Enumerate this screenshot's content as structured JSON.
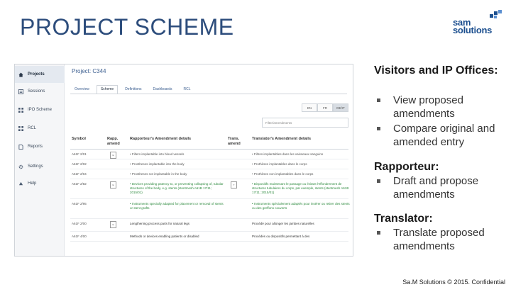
{
  "slide": {
    "title": "PROJECT SCHEME",
    "logo_line1": "sam",
    "logo_line2": "solutions",
    "footer": "Sa.M Solutions © 2015. Confidential"
  },
  "app": {
    "sidebar": {
      "items": [
        {
          "label": "Projects",
          "icon": "home-icon"
        },
        {
          "label": "Sessions",
          "icon": "list-icon"
        },
        {
          "label": "IPO Scheme",
          "icon": "grid-icon"
        },
        {
          "label": "RCL",
          "icon": "grid-icon"
        },
        {
          "label": "Reports",
          "icon": "document-icon"
        },
        {
          "label": "Settings",
          "icon": "gear-icon"
        },
        {
          "label": "Help",
          "icon": "help-icon"
        }
      ]
    },
    "project_title": "Project: C344",
    "tabs": [
      "Overview",
      "Scheme",
      "Definitions",
      "Dashboards",
      "RCL"
    ],
    "active_tab": "Scheme",
    "language_buttons": [
      "EN",
      "FR",
      "DE/IT"
    ],
    "filter_placeholder": "Filter/amendments",
    "table": {
      "headers": {
        "symbol": "Symbol",
        "rapp_amend": "Rapp. amend",
        "rapp_details": "Rapporteur's Amendment details",
        "trans_amend": "Trans. amend",
        "trans_details": "Translator's Amendment details"
      },
      "rows": [
        {
          "symbol": "A61F 2/01",
          "rapp_badge": "E",
          "rapp": "• Filters implantable into blood vessels",
          "trans_badge": "",
          "trans": "• Filtres implantables dans les vaisseaux sanguins"
        },
        {
          "symbol": "A61F 2/02",
          "rapp_badge": "",
          "rapp": "• Prostheses implantable into the body",
          "trans_badge": "",
          "trans": "• Prothèses implantables dans le corps"
        },
        {
          "symbol": "A61F 2/04",
          "rapp_badge": "",
          "rapp": "• Prostheses not implantable in the body",
          "trans_badge": "",
          "trans": "• Prothèses non implantables dans le corps"
        },
        {
          "symbol": "A61F 2/82",
          "rapp_badge": "E",
          "rapp": "• Devices providing patency to, or preventing collapsing of, tubular structures of the body, e.g. stents (stentmesh A61B 17/11; 2015/01)",
          "trans_badge": "T",
          "trans": "• Dispositifs maintenant le passage ou évitant l'effondrement de structures tubulaires du corps, par exemple, stents (stentmesh A61B 17/11; 2015/01)"
        },
        {
          "symbol": "A61F 2/95",
          "rapp_badge": "",
          "rapp": "• Instruments specially adapted for placement or removal of stents or stent grafts",
          "trans_badge": "",
          "trans": "• Instruments spécialement adaptés pour insérer ou retirer des stents ou des greffons couverts"
        },
        {
          "symbol": "A61F 2/00",
          "rapp_badge": "E",
          "rapp": "Lengthening process parts for natural legs",
          "trans_badge": "",
          "trans": "Procédé pour allonger les jambes naturelles"
        },
        {
          "symbol": "A61F 4/00",
          "rapp_badge": "",
          "rapp": "Methods or devices enabling patients or disabled",
          "trans_badge": "",
          "trans": "Procédés ou dispositifs permettant à des"
        }
      ]
    }
  },
  "sections": [
    {
      "heading": "Visitors and IP Offices:",
      "bullets": [
        "View proposed amendments",
        "Compare original and amended entry"
      ]
    },
    {
      "heading": "Rapporteur:",
      "bullets": [
        "Draft and propose amendments"
      ]
    },
    {
      "heading": "Translator:",
      "bullets": [
        "Translate proposed amendments"
      ]
    }
  ]
}
